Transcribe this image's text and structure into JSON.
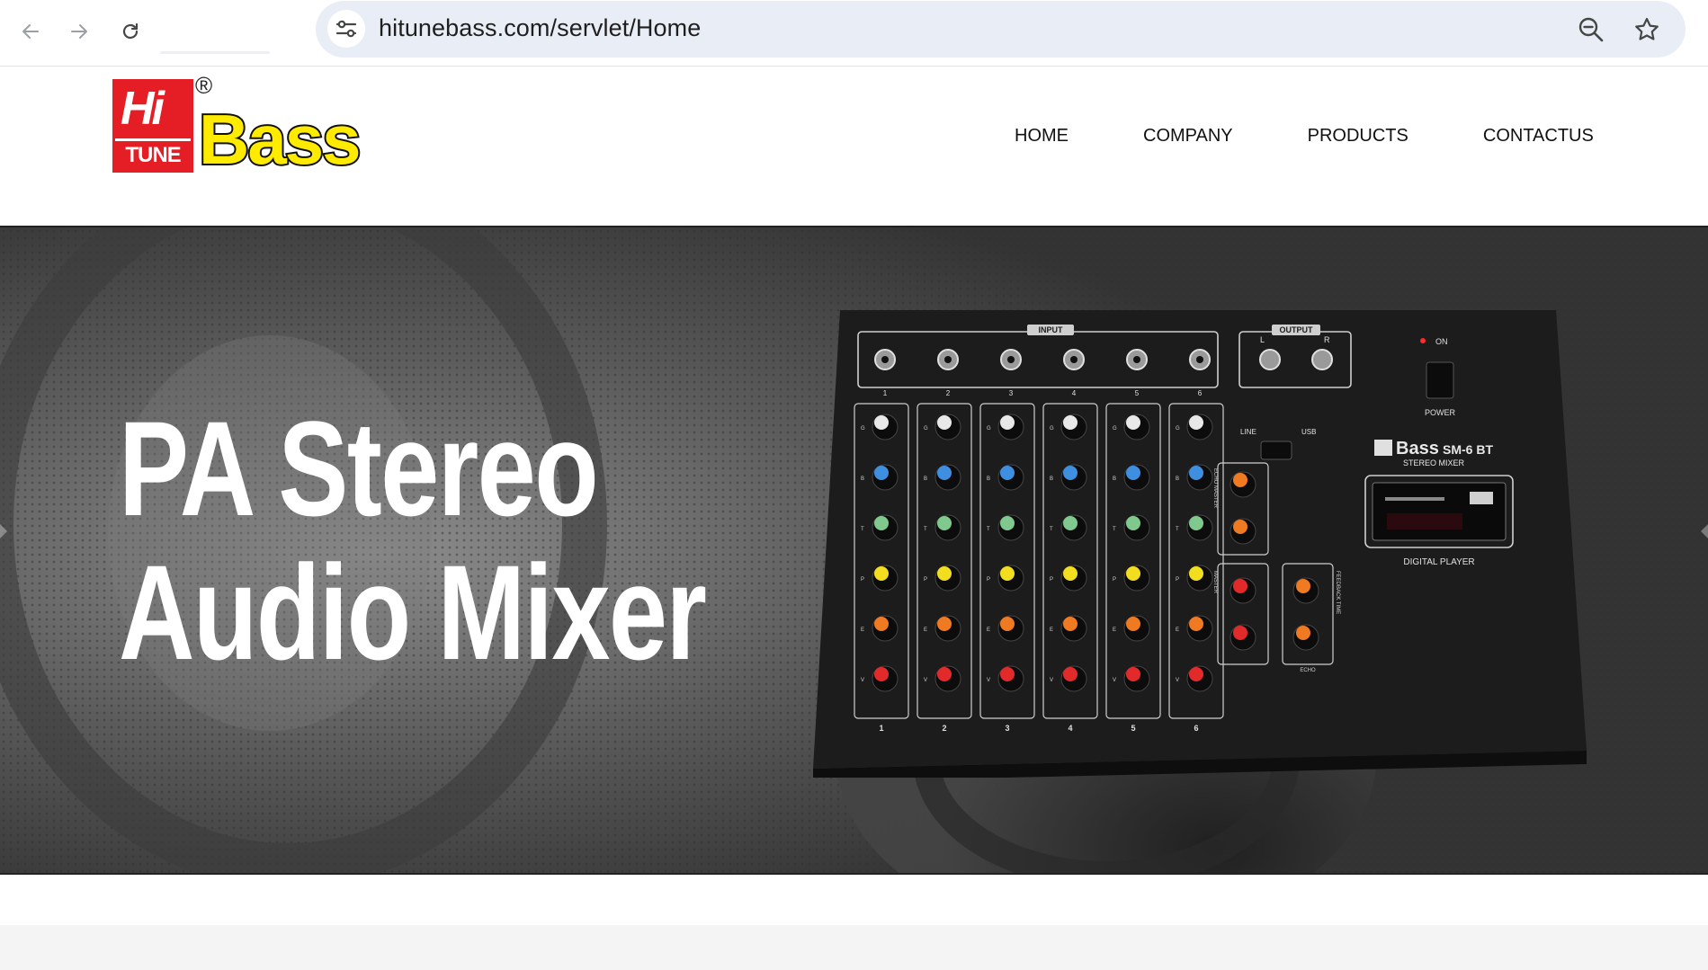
{
  "browser": {
    "url": "hitunebass.com/servlet/Home",
    "icons": {
      "back": "arrow-left-icon",
      "forward": "arrow-right-icon",
      "reload": "reload-icon",
      "site_info": "tune-icon",
      "zoom": "zoom-out-icon",
      "bookmark": "star-icon"
    }
  },
  "site": {
    "logo": {
      "top_text": "Hi",
      "bottom_text": "TUNE",
      "brand": "Bass",
      "reg_mark": "®",
      "colors": {
        "red": "#e41e24",
        "yellow": "#ffeb00",
        "outline": "#111111"
      }
    },
    "nav": [
      {
        "label": "HOME"
      },
      {
        "label": "COMPANY"
      },
      {
        "label": "PRODUCTS"
      },
      {
        "label": "CONTACTUS"
      }
    ]
  },
  "hero": {
    "title_line1": "PA Stereo",
    "title_line2": "Audio Mixer",
    "mixer": {
      "input_label": "INPUT",
      "output_label": "OUTPUT",
      "out_l": "L",
      "out_r": "R",
      "power_on_label": "ON",
      "power_label": "POWER",
      "line_label": "LINE",
      "usb_label": "USB",
      "model_brand": "Bass",
      "model_name": "SM-6 BT",
      "model_sub": "STEREO MIXER",
      "digital_player_label": "DIGITAL PLAYER",
      "channel_numbers": [
        "1",
        "2",
        "3",
        "4",
        "5",
        "6"
      ],
      "knob_rows": [
        "GAIN",
        "BASS",
        "TREBLE",
        "PAN",
        "ECHO",
        "VOLUME"
      ],
      "echo_master_label": "ECHO MASTER",
      "master_label": "MASTER",
      "feedback_label": "FEEDBACK TIME",
      "echo_small_label": "ECHO"
    }
  }
}
